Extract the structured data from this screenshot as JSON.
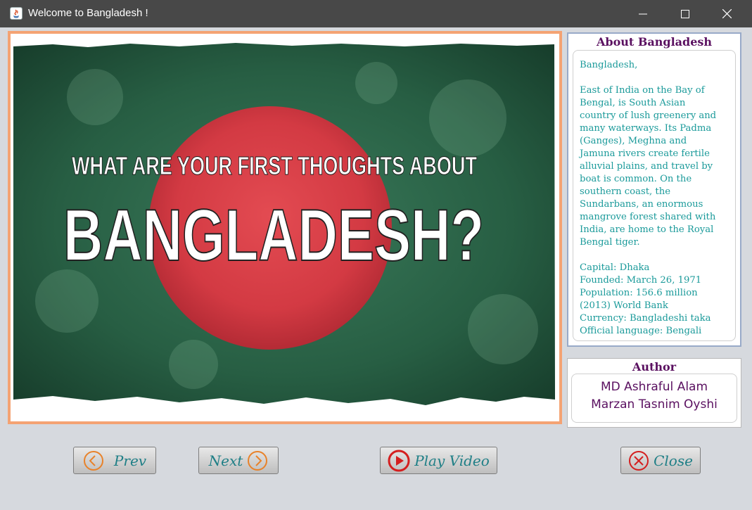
{
  "window": {
    "title": "Welcome to Bangladesh !",
    "icon": "java-icon",
    "controls": [
      "minimize-icon",
      "maximize-icon",
      "close-icon"
    ]
  },
  "banner": {
    "line1": "WHAT ARE YOUR FIRST THOUGHTS ABOUT",
    "line2": "BANGLADESH?",
    "colors": {
      "green": "#1f5a3a",
      "red": "#d63a42",
      "frame": "#f4a373"
    }
  },
  "about": {
    "title": "About Bangladesh",
    "lines": [
      "Bangladesh,",
      "",
      "East of India on the Bay of",
      "Bengal, is South Asian",
      "country of lush greenery and",
      "many waterways. Its Padma",
      "(Ganges), Meghna and",
      "Jamuna rivers create fertile",
      "alluvial plains, and travel by",
      "boat is common. On the",
      "southern coast, the",
      "Sundarbans, an enormous",
      "mangrove forest shared with",
      "India, are home to the Royal",
      "Bengal tiger.",
      "",
      "Capital: Dhaka",
      "Founded: March 26, 1971",
      "Population: 156.6 million",
      "(2013) World Bank",
      "Currency: Bangladeshi taka",
      "Official language: Bengali"
    ]
  },
  "author": {
    "title": "Author",
    "names": [
      "MD Ashraful Alam",
      "Marzan Tasnim Oyshi"
    ]
  },
  "buttons": {
    "prev": {
      "label": "Prev",
      "icon": "chevron-left-circle-icon"
    },
    "next": {
      "label": "Next",
      "icon": "chevron-right-circle-icon"
    },
    "play": {
      "label": "Play Video",
      "icon": "play-circle-icon"
    },
    "close": {
      "label": "Close",
      "icon": "close-circle-icon"
    }
  },
  "colors": {
    "accent_teal": "#1f7f86",
    "orange_icon": "#e8822a",
    "red_icon": "#d41f1f",
    "purple_title": "#5a1060"
  }
}
